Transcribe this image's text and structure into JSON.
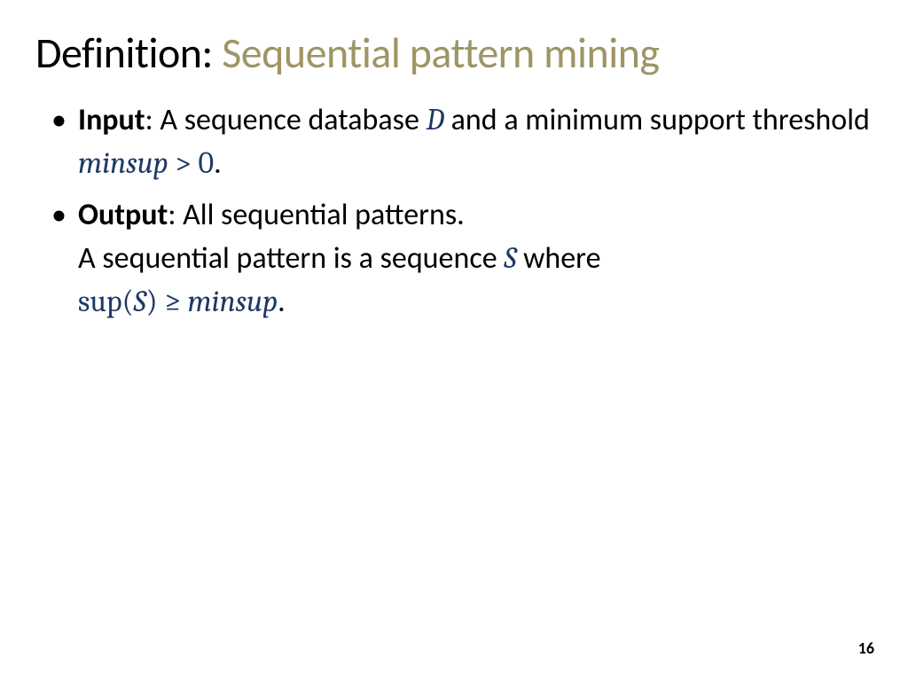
{
  "title": {
    "prefix": "Definition:",
    "main": " Sequential pattern mining"
  },
  "bullets": [
    {
      "label": "Input",
      "text_before": ": A sequence database ",
      "var1": "D",
      "text_mid": " and a minimum support threshold ",
      "var2": "minsup",
      "op": "  >  ",
      "num": "0",
      "text_after": "."
    },
    {
      "label": "Output",
      "text_before": ": All sequential patterns.",
      "line2_a": "A sequential pattern is a sequence ",
      "var1": "S",
      "line2_b": " where",
      "expr_func": "sup",
      "expr_open": "(",
      "expr_arg": "S",
      "expr_close": ")",
      "expr_op": " ≥ ",
      "expr_rhs": "minsup",
      "text_after": "."
    }
  ],
  "page_number": "16"
}
